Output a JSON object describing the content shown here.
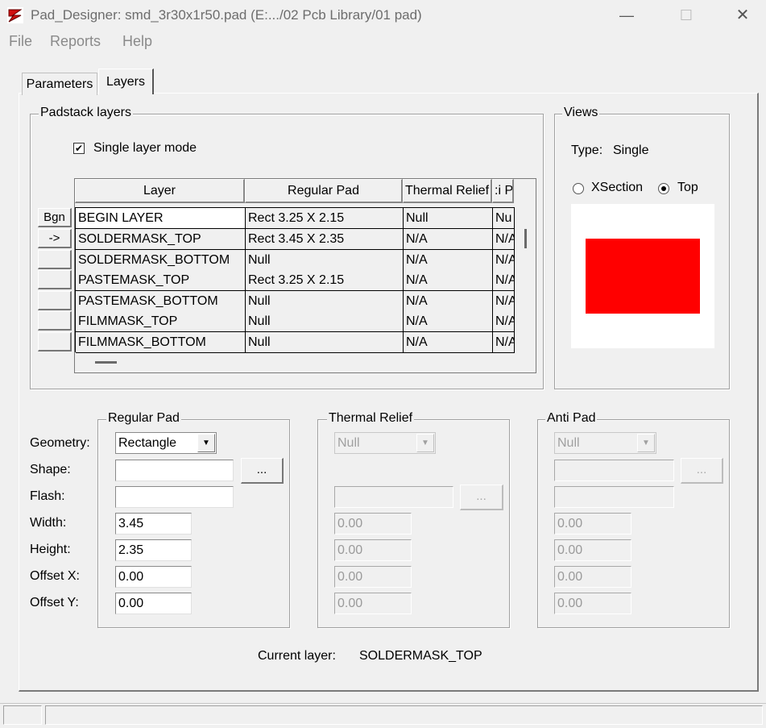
{
  "window": {
    "title": "Pad_Designer: smd_3r30x1r50.pad (E:.../02 Pcb Library/01 pad)",
    "minimize": "—",
    "maximize": "☐",
    "close": "✕"
  },
  "menu": {
    "items": [
      "File",
      "Reports",
      "Help"
    ]
  },
  "tabs": {
    "parameters": "Parameters",
    "layers": "Layers"
  },
  "padstack": {
    "group_title": "Padstack layers",
    "single_layer_mode_label": "Single layer mode",
    "single_layer_mode_checked": true,
    "columns": [
      "Layer",
      "Regular Pad",
      "Thermal Relief",
      ":i P"
    ],
    "row_buttons": [
      "Bgn",
      "->",
      "",
      "",
      "",
      "",
      ""
    ],
    "rows": [
      [
        "BEGIN LAYER",
        "Rect 3.25 X 2.15",
        "Null",
        "Nu"
      ],
      [
        "SOLDERMASK_TOP",
        "Rect 3.45 X 2.35",
        "N/A",
        "N/A"
      ],
      [
        "SOLDERMASK_BOTTOM",
        "Null",
        "N/A",
        "N/A"
      ],
      [
        "PASTEMASK_TOP",
        "Rect 3.25 X 2.15",
        "N/A",
        "N/A"
      ],
      [
        "PASTEMASK_BOTTOM",
        "Null",
        "N/A",
        "N/A"
      ],
      [
        "FILMMASK_TOP",
        "Null",
        "N/A",
        "N/A"
      ],
      [
        "FILMMASK_BOTTOM",
        "Null",
        "N/A",
        "N/A"
      ]
    ]
  },
  "views": {
    "group_title": "Views",
    "type_label": "Type:",
    "type_value": "Single",
    "xsection_label": "XSection",
    "top_label": "Top",
    "selected": "Top",
    "pad_color": "#ff0000"
  },
  "regular_pad": {
    "group_title": "Regular Pad",
    "geometry": "Rectangle",
    "shape": "",
    "flash": "",
    "width": "3.45",
    "height": "2.35",
    "offset_x": "0.00",
    "offset_y": "0.00",
    "browse_label": "..."
  },
  "thermal_relief": {
    "group_title": "Thermal Relief",
    "geometry": "Null",
    "flash": "",
    "width": "0.00",
    "height": "0.00",
    "offset_x": "0.00",
    "offset_y": "0.00",
    "browse_label": "..."
  },
  "anti_pad": {
    "group_title": "Anti Pad",
    "geometry": "Null",
    "shape": "",
    "flash": "",
    "width": "0.00",
    "height": "0.00",
    "offset_x": "0.00",
    "offset_y": "0.00",
    "browse_label": "..."
  },
  "labels": {
    "geometry": "Geometry:",
    "shape": "Shape:",
    "flash": "Flash:",
    "width": "Width:",
    "height": "Height:",
    "offset_x": "Offset X:",
    "offset_y": "Offset Y:"
  },
  "current_layer": {
    "label": "Current layer:",
    "value": "SOLDERMASK_TOP"
  }
}
